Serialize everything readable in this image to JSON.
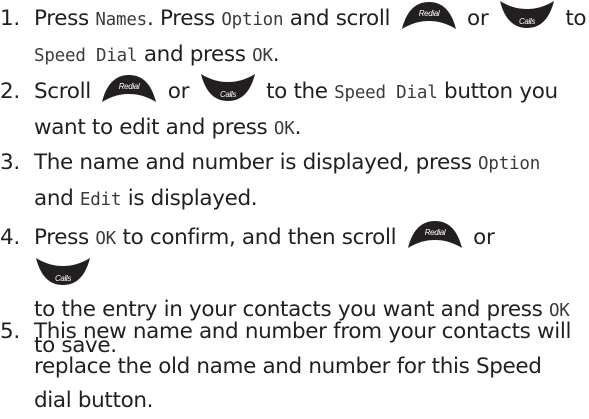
{
  "icons": {
    "up_key": "redial-up-key-icon",
    "down_key": "calls-down-key-icon",
    "up_key_text": "Redial",
    "down_key_text": "Calls",
    "key_color": "#231f20",
    "key_text_color": "#ffffff"
  },
  "steps": [
    {
      "number": "1.",
      "l1_a": "Press ",
      "l1_b": "Names",
      "l1_c": ". Press ",
      "l1_d": "Option",
      "l1_e": " and scroll ",
      "l1_f": " or ",
      "l1_g": " to",
      "l2_a": "Speed Dial",
      "l2_b": " and press ",
      "l2_c": "OK",
      "l2_d": "."
    },
    {
      "number": "2.",
      "l1_a": "Scroll ",
      "l1_b": " or ",
      "l1_c": " to the ",
      "l1_d": "Speed Dial",
      "l1_e": " button you",
      "l2_a": "want to edit and press ",
      "l2_b": "OK",
      "l2_c": "."
    },
    {
      "number": "3.",
      "l1_a": "The name and number is displayed, press ",
      "l1_b": "Option",
      "l2_a": "and ",
      "l2_b": "Edit",
      "l2_c": " is displayed."
    },
    {
      "number": "4.",
      "l1_a": "Press ",
      "l1_b": "OK",
      "l1_c": " to confirm, and then scroll ",
      "l1_d": " or",
      "l2_a": "to the entry in your contacts you want and press ",
      "l2_b": "OK",
      "l3_a": "to save."
    },
    {
      "number": "5.",
      "l1": "This new name and number from your contacts will",
      "l2": "replace the old name and number for this Speed",
      "l3": "dial button."
    }
  ]
}
